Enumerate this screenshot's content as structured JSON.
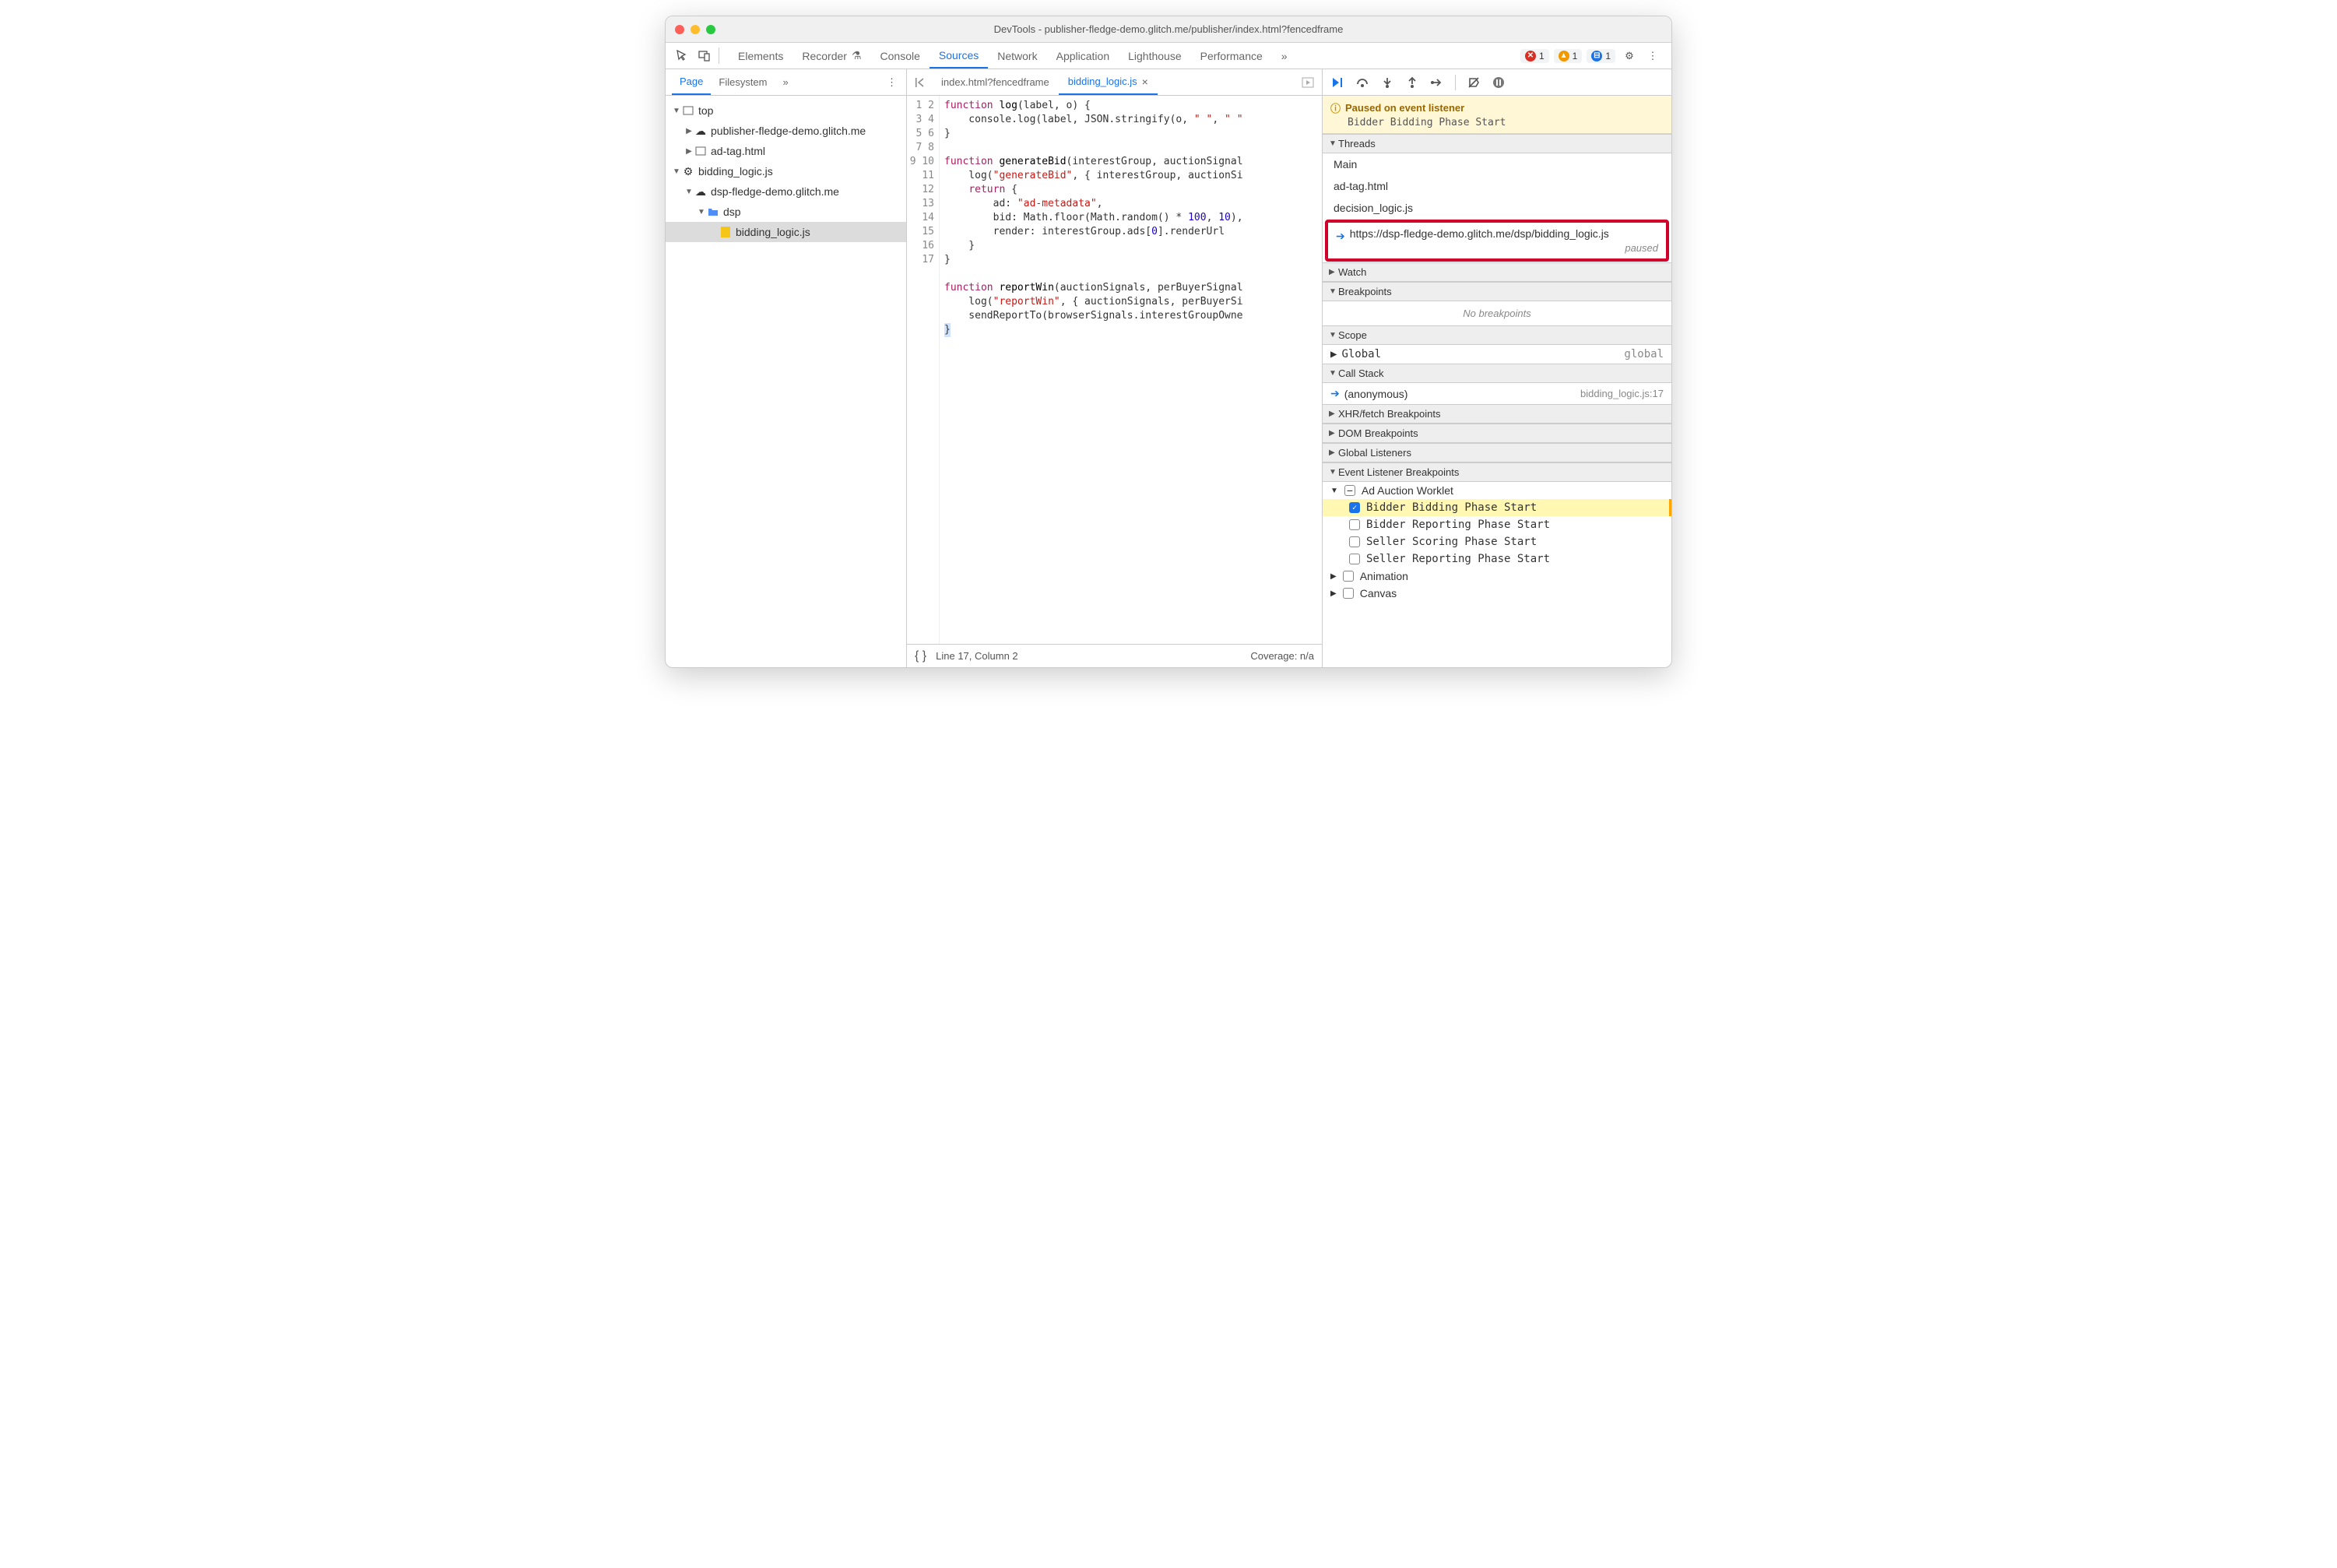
{
  "window_title": "DevTools - publisher-fledge-demo.glitch.me/publisher/index.html?fencedframe",
  "toolbar": {
    "tabs": [
      "Elements",
      "Recorder",
      "Console",
      "Sources",
      "Network",
      "Application",
      "Lighthouse",
      "Performance"
    ],
    "active_tab": "Sources",
    "errors": "1",
    "warnings": "1",
    "issues": "1"
  },
  "left": {
    "tabs": [
      "Page",
      "Filesystem"
    ],
    "active": "Page",
    "tree": {
      "top": "top",
      "pub": "publisher-fledge-demo.glitch.me",
      "adtag": "ad-tag.html",
      "bidding": "bidding_logic.js",
      "dsp_domain": "dsp-fledge-demo.glitch.me",
      "dsp_folder": "dsp",
      "bidding_file": "bidding_logic.js"
    }
  },
  "editor": {
    "tabs": [
      {
        "label": "index.html?fencedframe",
        "active": false
      },
      {
        "label": "bidding_logic.js",
        "active": true
      }
    ],
    "line_count": 17,
    "status_line": "Line 17, Column 2",
    "coverage": "Coverage: n/a"
  },
  "debugger": {
    "paused_title": "Paused on event listener",
    "paused_detail": "Bidder Bidding Phase Start",
    "sections": {
      "threads": "Threads",
      "watch": "Watch",
      "breakpoints": "Breakpoints",
      "scope": "Scope",
      "callstack": "Call Stack",
      "xhr": "XHR/fetch Breakpoints",
      "dom": "DOM Breakpoints",
      "global": "Global Listeners",
      "evt": "Event Listener Breakpoints"
    },
    "threads": {
      "main": "Main",
      "adtag": "ad-tag.html",
      "decision": "decision_logic.js",
      "highlighted": "https://dsp-fledge-demo.glitch.me/dsp/bidding_logic.js",
      "paused": "paused"
    },
    "no_breakpoints": "No breakpoints",
    "scope": {
      "global": "Global",
      "global_val": "global"
    },
    "stack": {
      "anon": "(anonymous)",
      "loc": "bidding_logic.js:17"
    },
    "evt_cat": {
      "adauction": "Ad Auction Worklet",
      "items": [
        {
          "label": "Bidder Bidding Phase Start",
          "checked": true,
          "hit": true
        },
        {
          "label": "Bidder Reporting Phase Start",
          "checked": false,
          "hit": false
        },
        {
          "label": "Seller Scoring Phase Start",
          "checked": false,
          "hit": false
        },
        {
          "label": "Seller Reporting Phase Start",
          "checked": false,
          "hit": false
        }
      ],
      "animation": "Animation",
      "canvas": "Canvas"
    }
  }
}
